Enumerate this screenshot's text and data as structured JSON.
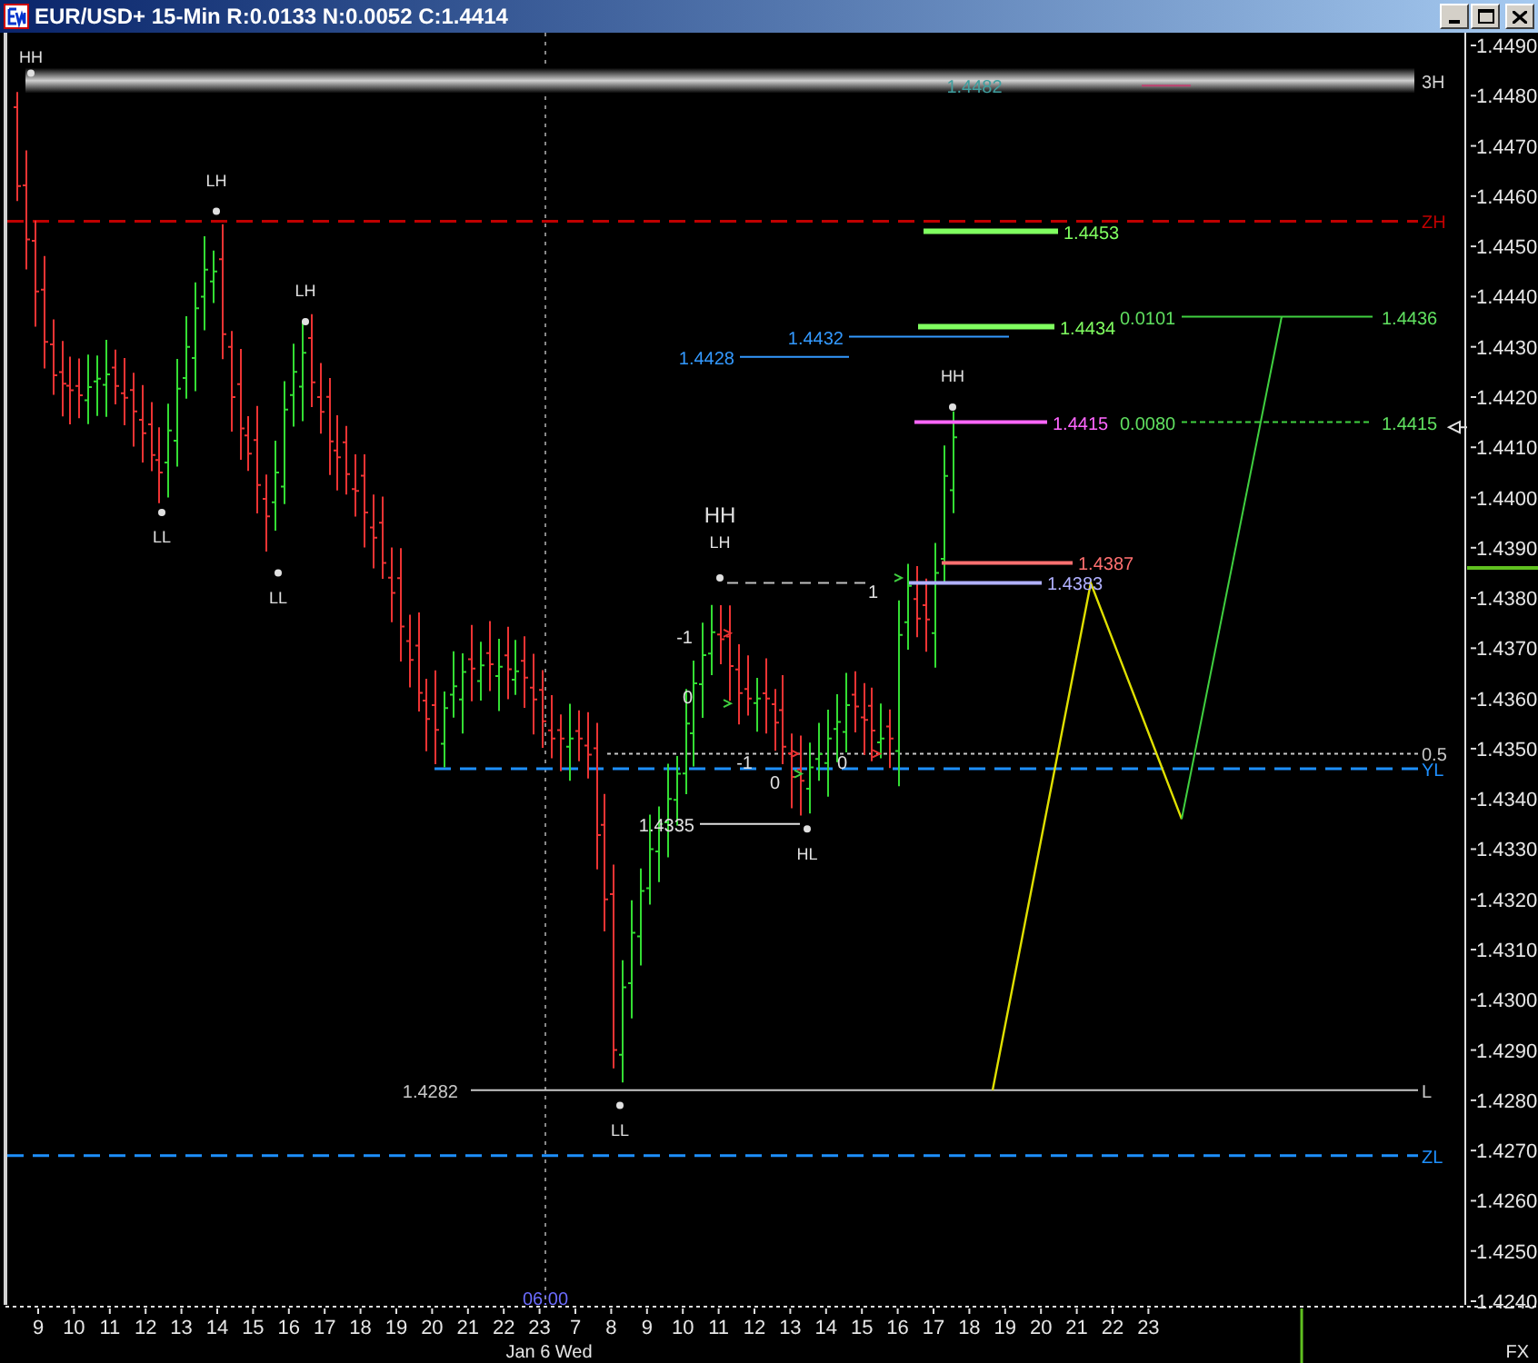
{
  "window": {
    "title": "EUR/USD+ 15-Min R:0.0133 N:0.0052 C:1.4414"
  },
  "price_axis": {
    "labels": [
      "1.4490",
      "1.4480",
      "1.4470",
      "1.4460",
      "1.4450",
      "1.4440",
      "1.4430",
      "1.4420",
      "1.4410",
      "1.4400",
      "1.4390",
      "1.4380",
      "1.4370",
      "1.4360",
      "1.4350",
      "1.4340",
      "1.4330",
      "1.4320",
      "1.4310",
      "1.4300",
      "1.4290",
      "1.4280",
      "1.4270",
      "1.4260",
      "1.4250",
      "1.4240"
    ]
  },
  "time_axis": {
    "labels": [
      "9",
      "10",
      "11",
      "12",
      "13",
      "14",
      "15",
      "16",
      "17",
      "18",
      "19",
      "20",
      "21",
      "22",
      "23",
      "7",
      "8",
      "9",
      "10",
      "11",
      "12",
      "13",
      "14",
      "15",
      "16",
      "17",
      "18",
      "19",
      "20",
      "21",
      "22",
      "23"
    ],
    "date_label": "Jan 6 Wed",
    "session_label": "06:00",
    "feed_label": "FX"
  },
  "level_lines": [
    {
      "kind": "band",
      "label": "3H",
      "color": "#d0d0d0"
    },
    {
      "kind": "dashed",
      "label": "ZH",
      "color": "#c00000"
    },
    {
      "kind": "dotted",
      "label": "0.5",
      "color": "#c8c8c8"
    },
    {
      "kind": "dashed",
      "label": "YL",
      "color": "#1e90ff"
    },
    {
      "kind": "solid",
      "label": "L",
      "color": "#c8c8c8"
    },
    {
      "kind": "dashed",
      "label": "ZL",
      "color": "#1e90ff"
    }
  ],
  "price_tags": [
    {
      "text": "1.4482",
      "color": "#40a0a0"
    },
    {
      "text": "1.4453",
      "color": "#80ff60"
    },
    {
      "text": "1.4434",
      "color": "#80ff60"
    },
    {
      "text": "1.4432",
      "color": "#3399ff"
    },
    {
      "text": "1.4428",
      "color": "#3399ff"
    },
    {
      "text": "1.4415",
      "color": "#ff66ff"
    },
    {
      "text": "1.4387",
      "color": "#ff7070"
    },
    {
      "text": "1.4383",
      "color": "#b0b0ff"
    },
    {
      "text": "1.4335",
      "color": "#e0e0e0"
    },
    {
      "text": "1.4282",
      "color": "#c8c8c8"
    }
  ],
  "projections": [
    {
      "kind": "solid",
      "range": "0.0101",
      "target": "1.4436"
    },
    {
      "kind": "dotted",
      "range": "0.0080",
      "target": "1.4415"
    }
  ],
  "swing_labels": [
    "HH",
    "LH",
    "LH",
    "LL",
    "LL",
    "HH",
    "LH",
    "LL",
    "HL",
    "HH"
  ],
  "counters": [
    "1",
    "-1",
    "0",
    "-1",
    "0",
    "0"
  ]
}
